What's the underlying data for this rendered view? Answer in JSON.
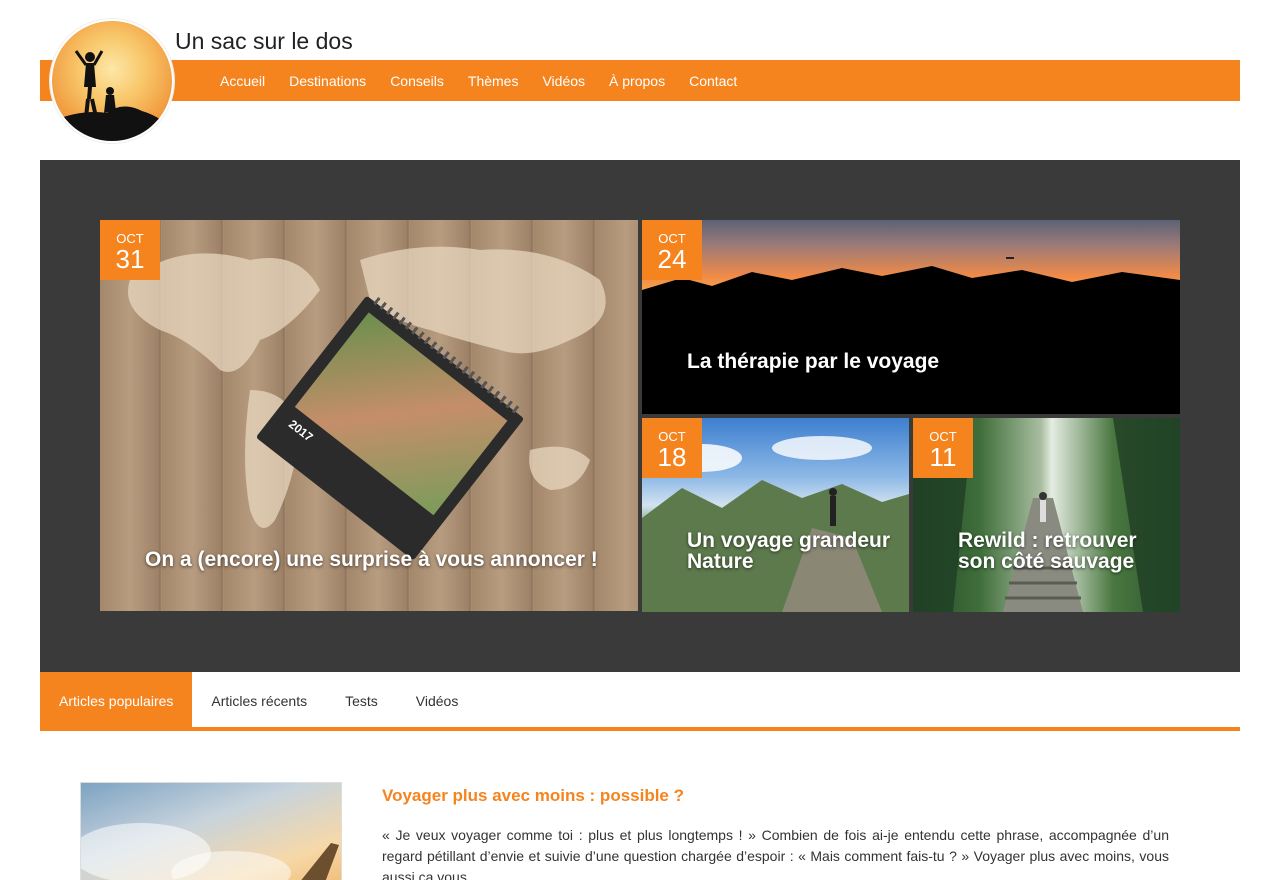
{
  "site": {
    "title": "Un sac sur le dos",
    "logo_icon": "hikers-silhouette-icon"
  },
  "nav": {
    "items": [
      "Accueil",
      "Destinations",
      "Conseils",
      "Thèmes",
      "Vidéos",
      "À propos",
      "Contact"
    ]
  },
  "featured": [
    {
      "month": "OCT",
      "day": "31",
      "title": "On a (encore) une surprise à vous annoncer !"
    },
    {
      "month": "OCT",
      "day": "24",
      "title": "La thérapie par le voyage"
    },
    {
      "month": "OCT",
      "day": "18",
      "title": "Un voyage grandeur Nature"
    },
    {
      "month": "OCT",
      "day": "11",
      "title": "Rewild : retrouver son côté sauvage"
    }
  ],
  "calendar_year": "2017",
  "tabs": [
    "Articles populaires",
    "Articles récents",
    "Tests",
    "Vidéos"
  ],
  "article": {
    "title": "Voyager plus avec moins : possible ?",
    "excerpt": "« Je veux voyager comme toi : plus et plus longtemps ! » Combien de fois ai-je entendu cette phrase, accompagnée d’un regard pétillant d’envie et suivie d’une question chargée d’espoir : « Mais comment fais-tu ? » Voyager plus avec moins, vous aussi ça vous"
  },
  "colors": {
    "accent": "#f5841f",
    "hero_bg": "#3a3a3a"
  }
}
